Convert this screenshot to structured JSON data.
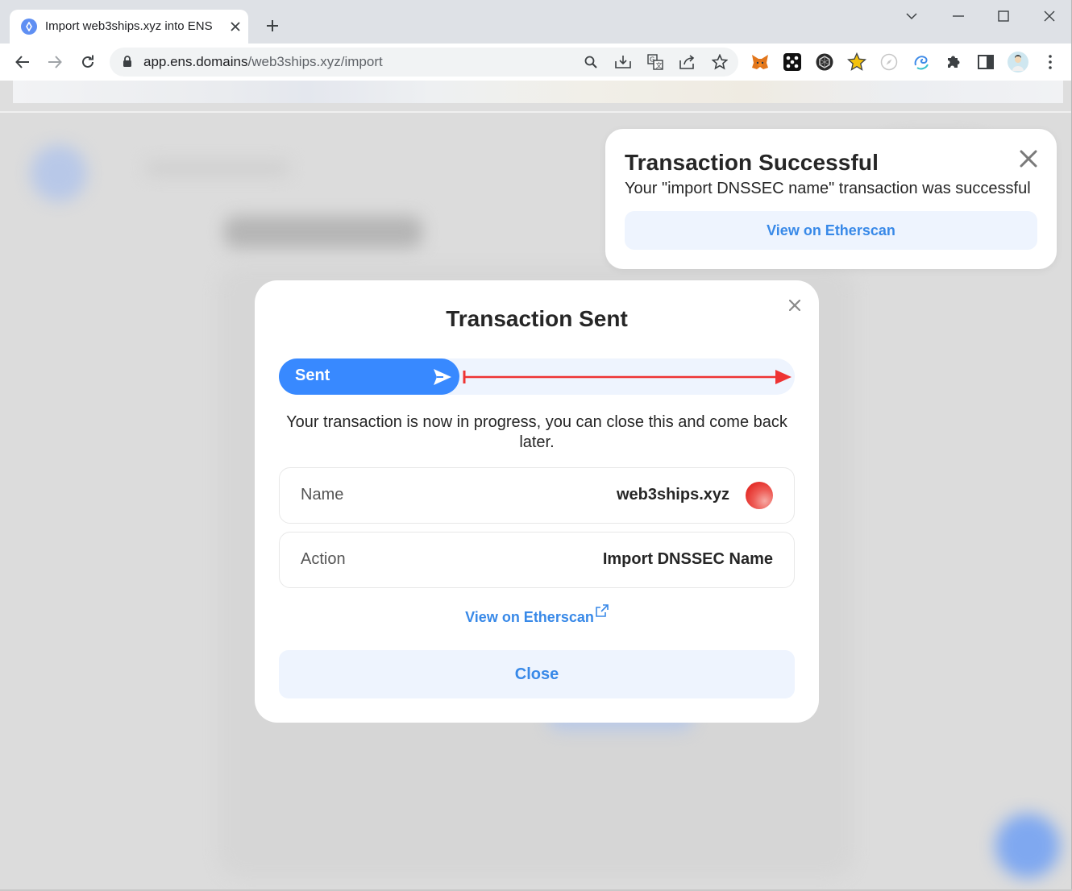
{
  "browser": {
    "tab_title": "Import web3ships.xyz into ENS",
    "url_domain": "app.ens.domains",
    "url_path": "/web3ships.xyz/import",
    "icons": {
      "tab_favicon": "ens-logo-icon",
      "tab_close": "close-icon",
      "new_tab": "plus-icon",
      "tab_search": "chevron-down-icon",
      "minimize": "minimize-icon",
      "maximize": "maximize-icon",
      "close_window": "close-icon",
      "back": "back-arrow-icon",
      "forward": "forward-arrow-icon",
      "reload": "reload-icon",
      "lock": "lock-icon",
      "zoom": "search-icon",
      "install": "install-icon",
      "translate": "translate-icon",
      "share": "share-icon",
      "bookmark": "star-outline-icon",
      "extensions": [
        "metamask-icon",
        "grid-extension-icon",
        "hexagon-extension-icon",
        "star-extension-icon",
        "compass-extension-icon",
        "swirl-extension-icon",
        "puzzle-icon",
        "side-panel-icon",
        "profile-avatar",
        "menu-icon"
      ]
    }
  },
  "toast": {
    "title": "Transaction Successful",
    "message": "Your \"import DNSSEC name\" transaction was successful",
    "button_label": "View on Etherscan"
  },
  "modal": {
    "title": "Transaction Sent",
    "progress_label": "Sent",
    "progress_text": "Your transaction is now in progress, you can close this and come back later.",
    "rows": [
      {
        "label": "Name",
        "value": "web3ships.xyz"
      },
      {
        "label": "Action",
        "value": "Import DNSSEC Name"
      }
    ],
    "etherscan_link": "View on Etherscan",
    "close_label": "Close"
  },
  "colors": {
    "accent": "#3889ff",
    "link": "#3889e8",
    "soft_blue": "#eef4fe",
    "annotation_red": "#ee3333"
  }
}
